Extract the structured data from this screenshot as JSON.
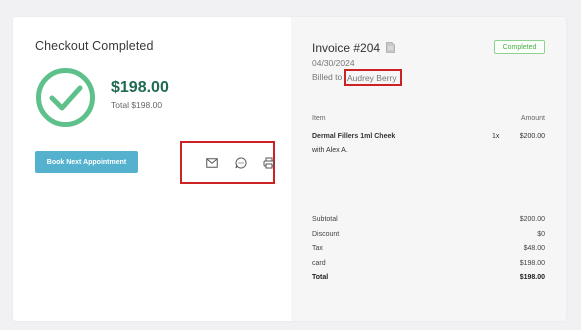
{
  "checkout": {
    "title": "Checkout Completed",
    "amount": "$198.00",
    "total_line": "Total $198.00",
    "book_button": "Book Next Appointment",
    "actions": [
      {
        "icon": "mail-icon",
        "name": "email-receipt-button"
      },
      {
        "icon": "chat-icon",
        "name": "sms-receipt-button"
      },
      {
        "icon": "printer-icon",
        "name": "print-receipt-button"
      }
    ]
  },
  "invoice": {
    "title": "Invoice #204",
    "status": "Completed",
    "date": "04/30/2024",
    "billed_label": "Billed to",
    "billed_name": "Audrey Berry",
    "columns": {
      "item": "Item",
      "amount": "Amount"
    },
    "items": [
      {
        "name": "Dermal Fillers 1ml Cheek",
        "with": "with Alex A.",
        "qty": "1x",
        "price": "$200.00"
      }
    ],
    "totals": [
      {
        "label": "Subtotal",
        "value": "$200.00"
      },
      {
        "label": "Discount",
        "value": "$0"
      },
      {
        "label": "Tax",
        "value": "$48.00"
      },
      {
        "label": "card",
        "value": "$198.00"
      },
      {
        "label": "Total",
        "value": "$198.00"
      }
    ]
  },
  "colors": {
    "accent_green": "#5ec08a",
    "amount_green": "#1f6b4f",
    "button_blue": "#55b2cf",
    "highlight_red": "#cc2222",
    "status_green": "#4cae4c"
  }
}
